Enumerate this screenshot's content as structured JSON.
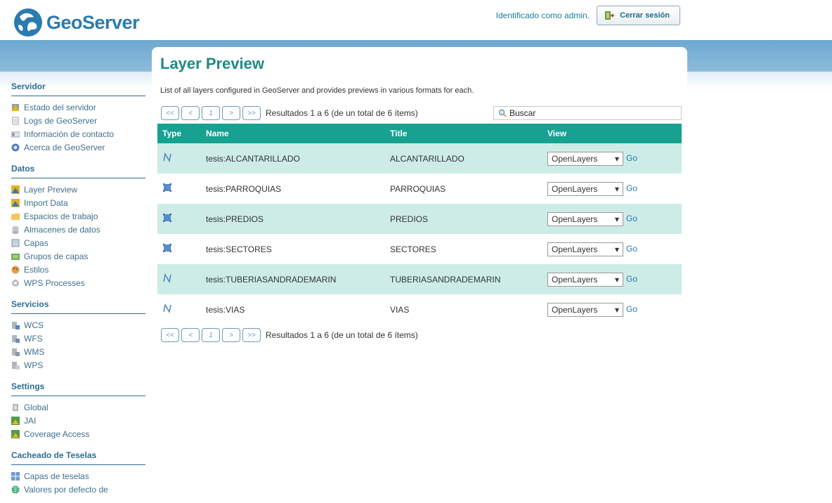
{
  "app": {
    "logo_text": "GeoServer",
    "user_label": "Identificado como admin.",
    "logout_label": "Cerrar sesión"
  },
  "colors": {
    "accent_teal": "#16a191",
    "row_alt": "#cdece7",
    "band_blue": "#7fb1d6",
    "link_blue": "#2a7ab0"
  },
  "sidebar": {
    "sections": [
      {
        "title": "Servidor",
        "items": [
          {
            "label": "Estado del servidor",
            "icon": "server-status-icon"
          },
          {
            "label": "Logs de GeoServer",
            "icon": "log-file-icon"
          },
          {
            "label": "Información de contacto",
            "icon": "contact-card-icon"
          },
          {
            "label": "Acerca de GeoServer",
            "icon": "info-icon"
          }
        ]
      },
      {
        "title": "Datos",
        "items": [
          {
            "label": "Layer Preview",
            "icon": "layer-preview-icon"
          },
          {
            "label": "Import Data",
            "icon": "import-icon"
          },
          {
            "label": "Espacios de trabajo",
            "icon": "folder-icon"
          },
          {
            "label": "Almacenes de datos",
            "icon": "datastore-icon"
          },
          {
            "label": "Capas",
            "icon": "layers-icon"
          },
          {
            "label": "Grupos de capas",
            "icon": "layer-group-icon"
          },
          {
            "label": "Estilos",
            "icon": "palette-icon"
          },
          {
            "label": "WPS Processes",
            "icon": "gear-icon"
          }
        ]
      },
      {
        "title": "Servicios",
        "items": [
          {
            "label": "WCS",
            "icon": "service-icon"
          },
          {
            "label": "WFS",
            "icon": "service-icon"
          },
          {
            "label": "WMS",
            "icon": "service-icon"
          },
          {
            "label": "WPS",
            "icon": "service-icon"
          }
        ]
      },
      {
        "title": "Settings",
        "items": [
          {
            "label": "Global",
            "icon": "global-settings-icon"
          },
          {
            "label": "JAI",
            "icon": "jai-icon"
          },
          {
            "label": "Coverage Access",
            "icon": "coverage-icon"
          }
        ]
      },
      {
        "title": "Cacheado de Teselas",
        "items": [
          {
            "label": "Capas de teselas",
            "icon": "tile-layers-icon"
          },
          {
            "label": "Valores por defecto de",
            "icon": "globe-icon"
          }
        ]
      }
    ]
  },
  "main": {
    "title": "Layer Preview",
    "description": "List of all layers configured in GeoServer and provides previews in various formats for each.",
    "pager": {
      "first": "<<",
      "prev": "<",
      "page": "1",
      "next": ">",
      "last": ">>",
      "info": "Resultados 1 a 6 (de un total de 6 ítems)"
    },
    "search_placeholder": "Buscar",
    "columns": [
      "Type",
      "Name",
      "Title",
      "View"
    ],
    "rows": [
      {
        "type": "line",
        "name": "tesis:ALCANTARILLADO",
        "title": "ALCANTARILLADO",
        "view": "OpenLayers",
        "go": "Go"
      },
      {
        "type": "polygon",
        "name": "tesis:PARROQUIAS",
        "title": "PARROQUIAS",
        "view": "OpenLayers",
        "go": "Go"
      },
      {
        "type": "polygon",
        "name": "tesis:PREDIOS",
        "title": "PREDIOS",
        "view": "OpenLayers",
        "go": "Go"
      },
      {
        "type": "polygon",
        "name": "tesis:SECTORES",
        "title": "SECTORES",
        "view": "OpenLayers",
        "go": "Go"
      },
      {
        "type": "line",
        "name": "tesis:TUBERIASANDRADEMARIN",
        "title": "TUBERIASANDRADEMARIN",
        "view": "OpenLayers",
        "go": "Go"
      },
      {
        "type": "line",
        "name": "tesis:VIAS",
        "title": "VIAS",
        "view": "OpenLayers",
        "go": "Go"
      }
    ]
  }
}
